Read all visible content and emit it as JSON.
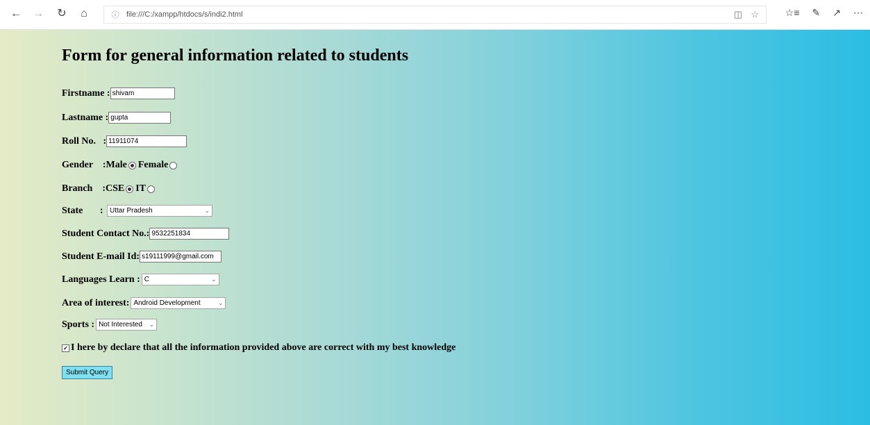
{
  "browser": {
    "url": "file:///C:/xampp/htdocs/s/indi2.html"
  },
  "form": {
    "title": "Form for general information related to students",
    "firstname": {
      "label": "Firstname :",
      "value": "shivam"
    },
    "lastname": {
      "label": "Lastname :",
      "value": "gupta"
    },
    "rollno": {
      "label": "Roll No.   :",
      "value": "11911074"
    },
    "gender": {
      "label": "Gender    :",
      "option1": "Male",
      "option2": "Female",
      "selected": "Male"
    },
    "branch": {
      "label": "Branch    :",
      "option1": "CSE",
      "option2": "IT",
      "selected": "CSE"
    },
    "state": {
      "label": "State       : ",
      "value": "Uttar Pradesh"
    },
    "contact": {
      "label": "Student Contact No.:",
      "value": "9532251834"
    },
    "email": {
      "label": "Student E-mail Id:",
      "value": "s19111999@gmail.com"
    },
    "languages": {
      "label": "Languages Learn :",
      "value": "C"
    },
    "interest": {
      "label": "Area of interest:",
      "value": "Android Development"
    },
    "sports": {
      "label": "Sports :",
      "value": "Not Interested"
    },
    "declaration": {
      "label": "I here by declare that all the information provided above are correct with my best knowledge",
      "checked": true
    },
    "submit_label": "Submit Query"
  }
}
